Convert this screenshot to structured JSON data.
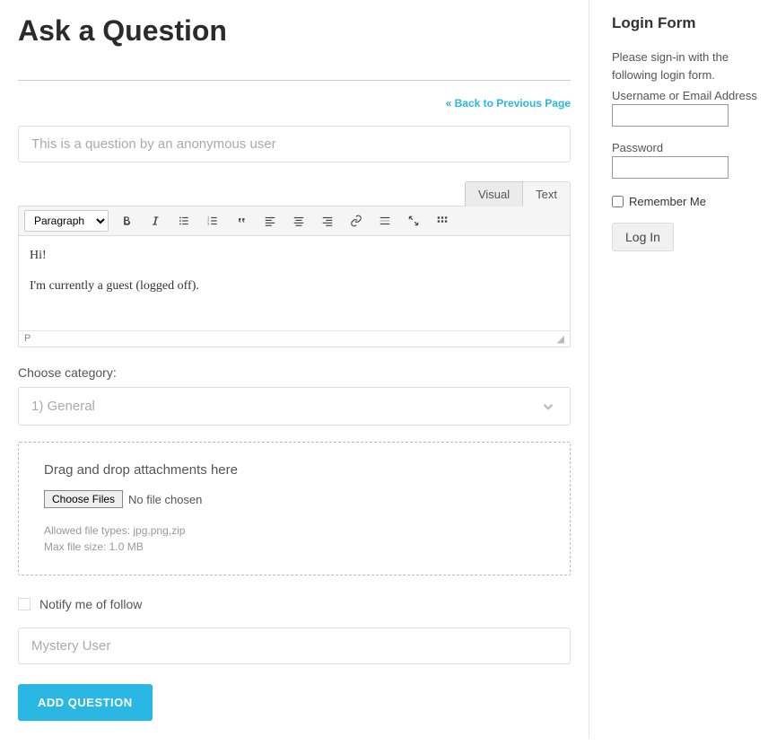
{
  "main": {
    "title": "Ask a Question",
    "back_link": "« Back to Previous Page",
    "question_title_placeholder": "This is a question by an anonymous user",
    "tabs": {
      "visual": "Visual",
      "text": "Text"
    },
    "format_select": "Paragraph",
    "editor_line1": "Hi!",
    "editor_line2": "I'm currently a guest (logged off).",
    "editor_status_path": "P",
    "category_label": "Choose category:",
    "category_selected": "1) General",
    "dropzone": {
      "title": "Drag and drop attachments here",
      "choose_btn": "Choose Files",
      "no_file": "No file chosen",
      "allowed": "Allowed file types: jpg,png,zip",
      "maxsize": "Max file size: 1.0 MB"
    },
    "notify_label": "Notify me of follow",
    "name_placeholder": "Mystery User",
    "submit": "Add Question"
  },
  "login": {
    "heading": "Login Form",
    "instruction": "Please sign-in with the following login form.",
    "username_label": "Username or Email Address",
    "password_label": "Password",
    "remember": "Remember Me",
    "button": "Log In"
  }
}
